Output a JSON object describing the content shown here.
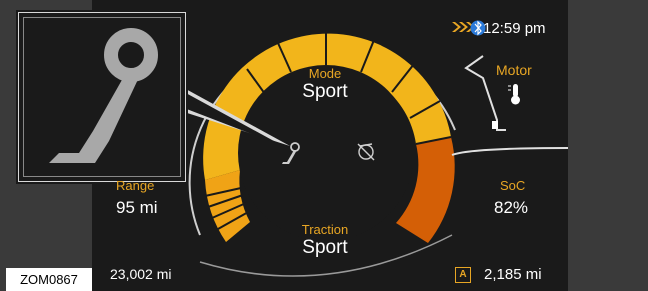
{
  "header": {
    "time": "12:59 pm"
  },
  "mode": {
    "label": "Mode",
    "value": "Sport"
  },
  "traction": {
    "label": "Traction",
    "value": "Sport"
  },
  "range": {
    "label": "Range",
    "value": "95 mi"
  },
  "soc": {
    "label": "SoC",
    "value": "82%"
  },
  "motor": {
    "label": "Motor"
  },
  "odometer": {
    "value": "23,002 mi"
  },
  "trip": {
    "badge": "A",
    "value": "2,185 mi"
  },
  "figure_ref": "ZOM0867",
  "icons": {
    "callout": "brake-pedal-icon",
    "pedal_small": "brake-pedal-icon",
    "traction_off": "traction-off-icon",
    "charging": "charging-chevrons-icon",
    "bluetooth": "bluetooth-icon",
    "motor_temp": "thermometer-icon"
  },
  "colors": {
    "gauge_yellow": "#f2b51b",
    "gauge_orange": "#d45f06",
    "label_amber": "#e8a624",
    "background": "#1a1a1a"
  }
}
